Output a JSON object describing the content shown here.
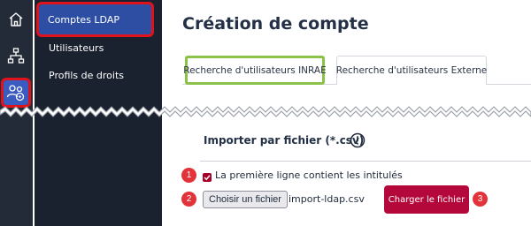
{
  "rail": {
    "icons": [
      "home-icon",
      "network-icon",
      "users-icon"
    ]
  },
  "submenu": {
    "items": [
      {
        "label": "Comptes LDAP",
        "active": true
      },
      {
        "label": "Utilisateurs",
        "active": false
      },
      {
        "label": "Profils de droits",
        "active": false
      }
    ]
  },
  "page": {
    "title": "Création de compte",
    "tabs": [
      {
        "label": "Recherche d'utilisateurs INRAE",
        "active": true
      },
      {
        "label": "Recherche d'utilisateurs Externe",
        "active": false
      }
    ]
  },
  "import": {
    "section_title": "Importer par fichier (*.csv)",
    "checkbox_label": "La première ligne contient les intitulés",
    "checkbox_checked": true,
    "file_button_label": "Choisir un fichier",
    "file_name": "import-ldap.csv",
    "load_button_label": "Charger le fichier"
  },
  "annotations": {
    "badges": [
      "1",
      "2",
      "3"
    ],
    "highlight_color": "#e0121b",
    "active_tab_color": "#8bc34a"
  },
  "colors": {
    "primary_button": "#b5083a",
    "sidebar_bg": "#1a2230",
    "active_menu": "#2e4ea3"
  }
}
